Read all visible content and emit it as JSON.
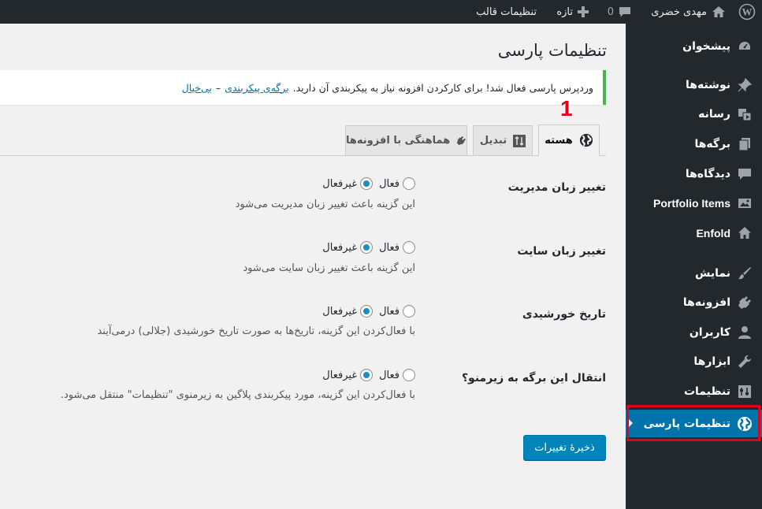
{
  "admin_bar": {
    "user_name": "مهدی خضری",
    "comments_count": "0",
    "new_label": "تازه",
    "theme_settings_label": "تنظیمات قالب"
  },
  "sidebar": {
    "items": [
      {
        "label": "پیشخوان",
        "icon": "dashboard-icon"
      },
      {
        "label": "نوشته‌ها",
        "icon": "pin-icon"
      },
      {
        "label": "رسانه",
        "icon": "media-icon"
      },
      {
        "label": "برگه‌ها",
        "icon": "pages-icon"
      },
      {
        "label": "دیدگاه‌ها",
        "icon": "comments-icon"
      },
      {
        "label": "Portfolio Items",
        "icon": "portfolio-icon"
      },
      {
        "label": "Enfold",
        "icon": "home-icon"
      },
      {
        "label": "نمایش",
        "icon": "brush-icon"
      },
      {
        "label": "افزونه‌ها",
        "icon": "plugin-icon"
      },
      {
        "label": "کاربران",
        "icon": "users-icon"
      },
      {
        "label": "ابزارها",
        "icon": "wrench-icon"
      },
      {
        "label": "تنظیمات",
        "icon": "settings-icon"
      },
      {
        "label": "تنظیمات پارسی",
        "icon": "globe-icon",
        "current": true
      }
    ]
  },
  "page": {
    "title": "تنظیمات پارسی",
    "notice_text": "وردپرس پارسی فعال شد! برای کارکردن افزونه نیاز به پیکربندی آن دارید.",
    "notice_link_config": "برگه‌ی پیکربندی",
    "notice_separator": "–",
    "notice_link_dismiss": "بی‌خیال",
    "step_number": "1"
  },
  "tabs": [
    {
      "label": "هسته",
      "icon": "globe-icon",
      "active": true
    },
    {
      "label": "تبدیل",
      "icon": "convert-icon",
      "active": false
    },
    {
      "label": "هماهنگی با افزونه‌ها",
      "icon": "plugin-icon",
      "active": false
    }
  ],
  "options": {
    "on_label": "فعال",
    "off_label": "غیرفعال"
  },
  "settings": [
    {
      "label": "تغییر زبان مدیریت",
      "description": "این گزینه باعث تغییر زبان مدیریت می‌شود",
      "value": "off"
    },
    {
      "label": "تغییر زبان سایت",
      "description": "این گزینه باعث تغییر زبان سایت می‌شود",
      "value": "off"
    },
    {
      "label": "تاریخ خورشیدی",
      "description": "با فعال‌کردن این گزینه، تاریخ‌ها به صورت تاریخ خورشیدی (جلالی) درمی‌آیند",
      "value": "off"
    },
    {
      "label": "انتقال این برگه به زیرمنو؟",
      "description": "با فعال‌کردن این گزینه، مورد پیکربندی پلاگین به زیرمنوی \"تنظیمات\" منتقل می‌شود.",
      "value": "off"
    }
  ],
  "save_button_label": "ذخیرهٔ تغییرات",
  "colors": {
    "admin_bar": "#23282d",
    "sidebar": "#23282d",
    "accent": "#0073aa",
    "button": "#0085ba",
    "notice_border": "#46b450",
    "highlight_red": "#e3001b"
  }
}
